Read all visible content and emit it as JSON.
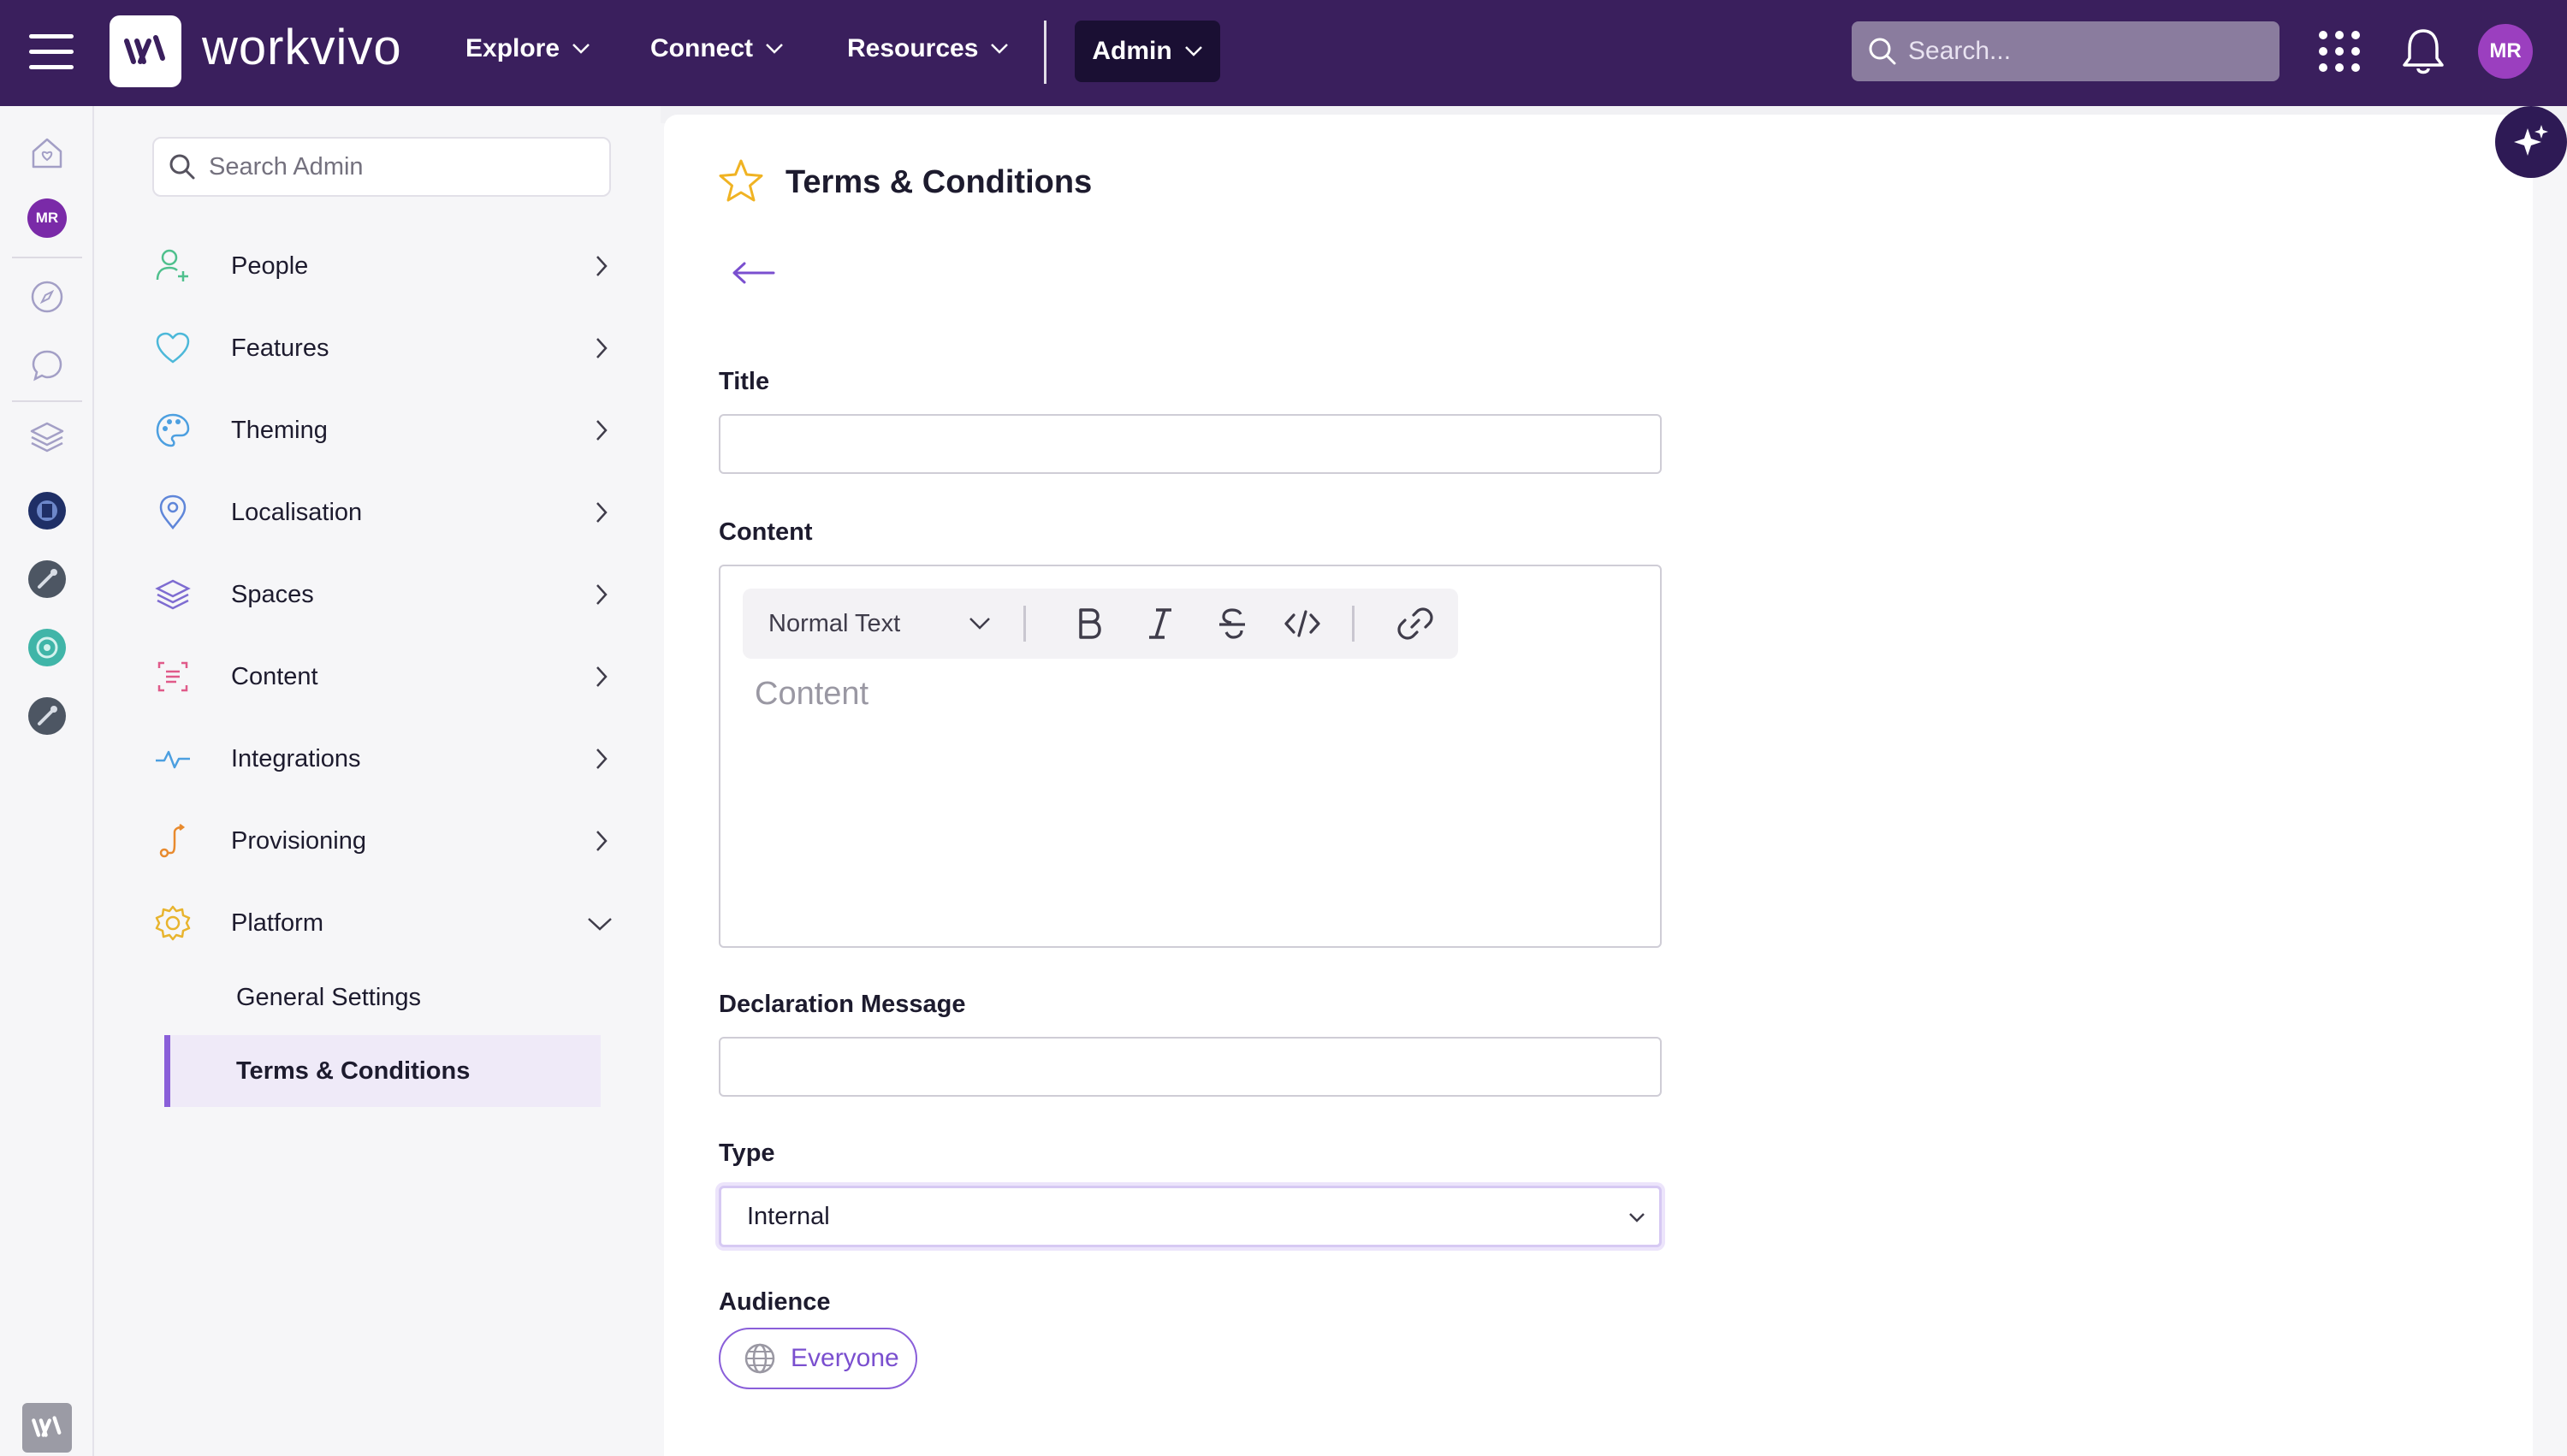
{
  "colors": {
    "topbar": "#3a1f5d",
    "accent": "#8a5fd9",
    "admin_btn": "#1a0f33",
    "avatar": "#9b3fbf"
  },
  "topbar": {
    "brand": "workvivo",
    "nav": [
      {
        "label": "Explore",
        "icon": "chevron-down-icon"
      },
      {
        "label": "Connect",
        "icon": "chevron-down-icon"
      },
      {
        "label": "Resources",
        "icon": "chevron-down-icon"
      }
    ],
    "admin_label": "Admin",
    "search_placeholder": "Search...",
    "avatar_initials": "MR"
  },
  "rail": {
    "avatar_initials": "MR",
    "icons": [
      "home-icon",
      "compass-icon",
      "chat-icon",
      "layers-icon",
      "space-avatar-1",
      "space-avatar-2",
      "space-avatar-3",
      "space-avatar-4"
    ]
  },
  "sidebar": {
    "search_placeholder": "Search Admin",
    "items": [
      {
        "label": "People",
        "icon": "user-add-icon"
      },
      {
        "label": "Features",
        "icon": "heart-icon"
      },
      {
        "label": "Theming",
        "icon": "palette-icon"
      },
      {
        "label": "Localisation",
        "icon": "map-pin-icon"
      },
      {
        "label": "Spaces",
        "icon": "layers-icon"
      },
      {
        "label": "Content",
        "icon": "content-icon"
      },
      {
        "label": "Integrations",
        "icon": "pulse-icon"
      },
      {
        "label": "Provisioning",
        "icon": "route-icon"
      },
      {
        "label": "Platform",
        "icon": "gear-icon",
        "expanded": true
      }
    ],
    "sub_items": [
      {
        "label": "General Settings",
        "active": false
      },
      {
        "label": "Terms & Conditions",
        "active": true
      }
    ]
  },
  "main": {
    "title": "Terms & Conditions",
    "fields": {
      "title_label": "Title",
      "title_value": "",
      "content_label": "Content",
      "content_placeholder": "Content",
      "text_style": "Normal Text",
      "declaration_label": "Declaration Message",
      "declaration_value": "",
      "type_label": "Type",
      "type_value": "Internal",
      "audience_label": "Audience",
      "audience_value": "Everyone"
    }
  }
}
